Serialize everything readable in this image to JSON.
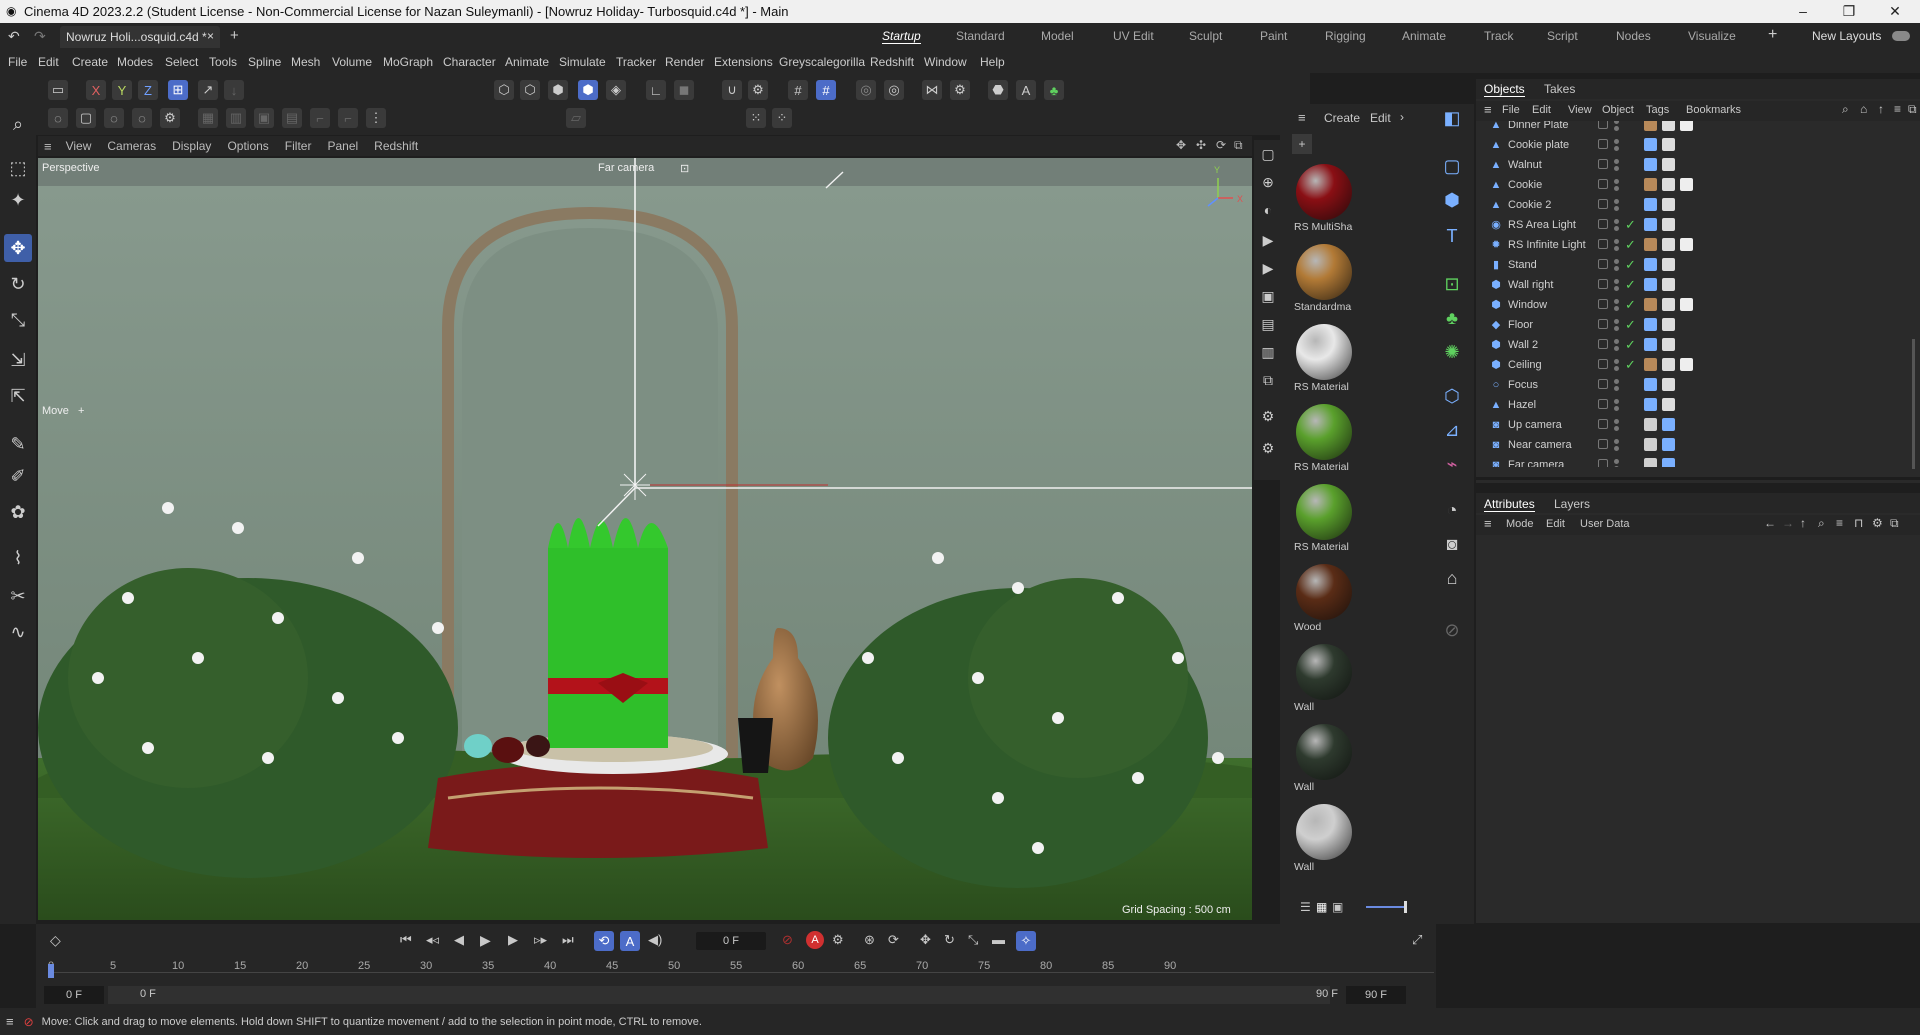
{
  "app": {
    "title": "Cinema 4D 2023.2.2 (Student License - Non-Commercial License for Nazan Suleymanli) - [Nowruz Holiday- Turbosquid.c4d *] - Main",
    "doc_tab": "Nowruz Holi...osquid.c4d *",
    "window_controls": [
      "–",
      "❐",
      "✕"
    ]
  },
  "layouts": [
    "Startup",
    "Standard",
    "Model",
    "UV Edit",
    "Sculpt",
    "Paint",
    "Rigging",
    "Animate",
    "Track",
    "Script",
    "Nodes",
    "Visualize"
  ],
  "active_layout": "Startup",
  "new_layouts": "New Layouts",
  "menu": [
    "File",
    "Edit",
    "Create",
    "Modes",
    "Select",
    "Tools",
    "Spline",
    "Mesh",
    "Volume",
    "MoGraph",
    "Character",
    "Animate",
    "Simulate",
    "Tracker",
    "Render",
    "Extensions",
    "Greyscalegorilla",
    "Redshift",
    "Window",
    "Help"
  ],
  "axes": {
    "x": "X",
    "y": "Y",
    "z": "Z"
  },
  "viewport": {
    "menu": [
      "View",
      "Cameras",
      "Display",
      "Options",
      "Filter",
      "Panel",
      "Redshift"
    ],
    "name": "Perspective",
    "camera": "Far camera",
    "tool": "Move",
    "grid_spacing": "Grid Spacing : 500 cm",
    "gizmo_y": "Y",
    "gizmo_x": "X"
  },
  "materials": {
    "menu": [
      "Create",
      "Edit"
    ],
    "items": [
      {
        "name": "RS MultiSha",
        "color": "#8a0f14"
      },
      {
        "name": "Standardma",
        "color": "#b27a36"
      },
      {
        "name": "RS Material",
        "color": "#e8e8e8"
      },
      {
        "name": "RS Material",
        "color": "#5aa02c"
      },
      {
        "name": "RS Material",
        "color": "#5aa02c"
      },
      {
        "name": "Wood",
        "color": "#5a2c16"
      },
      {
        "name": "Wall",
        "color": "#2e3a2e"
      },
      {
        "name": "Wall",
        "color": "#2e3a2e"
      },
      {
        "name": "Wall",
        "color": "#cfcfcf"
      }
    ]
  },
  "objects": {
    "tabs": [
      "Objects",
      "Takes"
    ],
    "menu": [
      "File",
      "Edit",
      "View",
      "Object",
      "Tags",
      "Bookmarks"
    ],
    "items": [
      {
        "name": "Dinner Plate",
        "icon": "mesh-icon",
        "check": false
      },
      {
        "name": "Cookie plate",
        "icon": "mesh-icon",
        "check": false
      },
      {
        "name": "Walnut",
        "icon": "mesh-icon",
        "check": false
      },
      {
        "name": "Cookie",
        "icon": "mesh-icon",
        "check": false
      },
      {
        "name": "Cookie 2",
        "icon": "mesh-icon",
        "check": false
      },
      {
        "name": "RS Area Light",
        "icon": "light-icon",
        "check": true
      },
      {
        "name": "RS Infinite Light",
        "icon": "sun-icon",
        "check": true
      },
      {
        "name": "Stand",
        "icon": "cylinder-icon",
        "check": true
      },
      {
        "name": "Wall right",
        "icon": "cube-icon",
        "check": true
      },
      {
        "name": "Window",
        "icon": "cube-icon",
        "check": true
      },
      {
        "name": "Floor",
        "icon": "plane-icon",
        "check": true
      },
      {
        "name": "Wall 2",
        "icon": "cube-icon",
        "check": true
      },
      {
        "name": "Ceiling",
        "icon": "cube-icon",
        "check": true
      },
      {
        "name": "Focus",
        "icon": "null-icon",
        "check": false
      },
      {
        "name": "Hazel",
        "icon": "mesh-icon",
        "check": false
      },
      {
        "name": "Up camera",
        "icon": "camera-icon",
        "check": false
      },
      {
        "name": "Near camera",
        "icon": "camera-icon",
        "check": false
      },
      {
        "name": "Far camera",
        "icon": "camera-icon",
        "check": false
      }
    ]
  },
  "attributes": {
    "tabs": [
      "Attributes",
      "Layers"
    ],
    "menu": [
      "Mode",
      "Edit",
      "User Data"
    ]
  },
  "timeline": {
    "current_frame": "0 F",
    "ticks": [
      "0",
      "5",
      "10",
      "15",
      "20",
      "25",
      "30",
      "35",
      "40",
      "45",
      "50",
      "55",
      "60",
      "65",
      "70",
      "75",
      "80",
      "85",
      "90"
    ],
    "start": "0 F",
    "min": "0 F",
    "max": "90 F",
    "end": "90 F"
  },
  "status": "Move: Click and drag to move elements. Hold down SHIFT to quantize movement / add to the selection in point mode, CTRL to remove."
}
